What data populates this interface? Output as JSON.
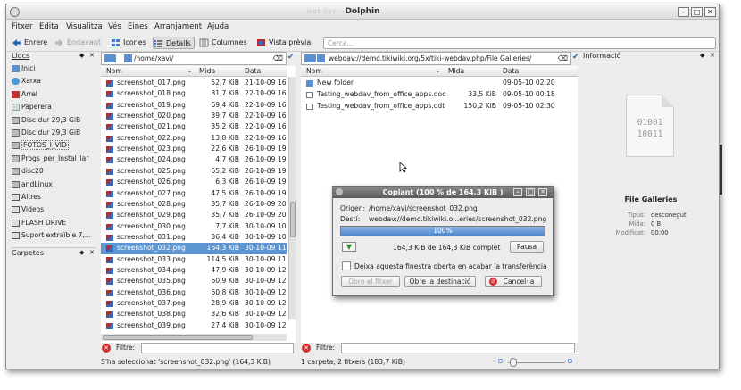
{
  "window": {
    "title": "Dolphin",
    "ghost_title": "webdav — Dolphin"
  },
  "menu": [
    "Fitxer",
    "Edita",
    "Visualitza",
    "Vés",
    "Eines",
    "Arranjament",
    "Ajuda"
  ],
  "toolbar": {
    "back": "Enrere",
    "forward": "Endavant",
    "icons": "Icones",
    "details": "Detalls",
    "columns": "Columnes",
    "preview": "Vista prèvia",
    "search_placeholder": "Cerca..."
  },
  "places": {
    "title": "Llocs",
    "items": [
      "Inici",
      "Xarxa",
      "Arrel",
      "Paperera",
      "Disc dur 29,3 GiB",
      "Disc dur 29,3 GiB",
      "FOTOS_I_VID",
      "Progs_per_Instal_lar",
      "disc20",
      "andLinux",
      "Altres",
      "Videos",
      "FLASH DRIVE",
      "Suport extraïble 7,..."
    ]
  },
  "folders_panel": {
    "title": "Carpetes"
  },
  "left_pane": {
    "path": "/home/xavi/",
    "columns": {
      "name": "Nom",
      "size": "Mida",
      "date": "Data"
    },
    "files": [
      {
        "name": "screenshot_017.png",
        "size": "52,7 KiB",
        "date": "21-10-09 16"
      },
      {
        "name": "screenshot_018.png",
        "size": "81,7 KiB",
        "date": "22-10-09 16"
      },
      {
        "name": "screenshot_019.png",
        "size": "69,4 KiB",
        "date": "22-10-09 16"
      },
      {
        "name": "screenshot_020.png",
        "size": "39,7 KiB",
        "date": "22-10-09 16"
      },
      {
        "name": "screenshot_021.png",
        "size": "35,2 KiB",
        "date": "22-10-09 16"
      },
      {
        "name": "screenshot_022.png",
        "size": "13,8 KiB",
        "date": "22-10-09 16"
      },
      {
        "name": "screenshot_023.png",
        "size": "22,6 KiB",
        "date": "26-10-09 19"
      },
      {
        "name": "screenshot_024.png",
        "size": "4,7 KiB",
        "date": "26-10-09 19"
      },
      {
        "name": "screenshot_025.png",
        "size": "65,2 KiB",
        "date": "26-10-09 19"
      },
      {
        "name": "screenshot_026.png",
        "size": "6,3 KiB",
        "date": "26-10-09 19"
      },
      {
        "name": "screenshot_027.png",
        "size": "47,5 KiB",
        "date": "26-10-09 19"
      },
      {
        "name": "screenshot_028.png",
        "size": "35,7 KiB",
        "date": "26-10-09 20"
      },
      {
        "name": "screenshot_029.png",
        "size": "35,7 KiB",
        "date": "26-10-09 20"
      },
      {
        "name": "screenshot_030.png",
        "size": "7,7 KiB",
        "date": "30-10-09 10"
      },
      {
        "name": "screenshot_031.png",
        "size": "36,4 KiB",
        "date": "30-10-09 10"
      },
      {
        "name": "screenshot_032.png",
        "size": "164,3 KiB",
        "date": "30-10-09 11"
      },
      {
        "name": "screenshot_033.png",
        "size": "114,5 KiB",
        "date": "30-10-09 11"
      },
      {
        "name": "screenshot_034.png",
        "size": "47,9 KiB",
        "date": "30-10-09 12"
      },
      {
        "name": "screenshot_035.png",
        "size": "60,9 KiB",
        "date": "30-10-09 12"
      },
      {
        "name": "screenshot_036.png",
        "size": "60,8 KiB",
        "date": "30-10-09 12"
      },
      {
        "name": "screenshot_037.png",
        "size": "28,9 KiB",
        "date": "30-10-09 12"
      },
      {
        "name": "screenshot_038.png",
        "size": "32,6 KiB",
        "date": "30-10-09 12"
      },
      {
        "name": "screenshot_039.png",
        "size": "27,4 KiB",
        "date": "30-10-09 12"
      }
    ],
    "selected_index": 15,
    "filter_label": "Filtre:",
    "status": "S'ha seleccionat 'screenshot_032.png' (164,3 KiB)"
  },
  "right_pane": {
    "path": "webdav://demo.tikiwiki.org/5x/tiki-webdav.php/File Galleries/",
    "columns": {
      "name": "Nom",
      "size": "Mida",
      "date": "Data"
    },
    "files": [
      {
        "name": "New folder",
        "size": "",
        "date": "09-05-10 02:20"
      },
      {
        "name": "Testing_webdav_from_office_apps.doc",
        "size": "33,5 KiB",
        "date": "09-05-10 00:18"
      },
      {
        "name": "Testing_webdav_from_office_apps.odt",
        "size": "150,2 KiB",
        "date": "09-05-10 02:30"
      }
    ],
    "filter_label": "Filtre:",
    "status": "1 carpeta, 2 fitxers (183,7 KiB)"
  },
  "info_panel": {
    "title": "Informació",
    "icon_text": [
      "01001",
      "10011"
    ],
    "name": "File Galleries",
    "fields": [
      {
        "label": "Tipus:",
        "value": "desconegut"
      },
      {
        "label": "Mida:",
        "value": "0 B"
      },
      {
        "label": "Modificat:",
        "value": "00:00"
      }
    ]
  },
  "copy_dialog": {
    "title": "Copiant (100 % de 164,3 KiB )",
    "origin_label": "Origen:",
    "origin": "/home/xavi/screenshot_032.png",
    "dest_label": "Destí:",
    "dest": "webdav://demo.tikiwiki.o...eries/screenshot_032.png",
    "progress": 100,
    "progress_text": "100%",
    "transfer": "164,3 KiB de 164,3 KiB complet",
    "pause": "Pausa",
    "keep_open": "Deixa aquesta finestra oberta en acabar la transferència",
    "open_file": "Obre el fitxer",
    "open_dest": "Obre la destinació",
    "cancel": "Cancel·la"
  },
  "colors": {
    "selection": "#5e96d3",
    "progress": "#5b8fd0",
    "cancel_red": "#d12f2f"
  }
}
